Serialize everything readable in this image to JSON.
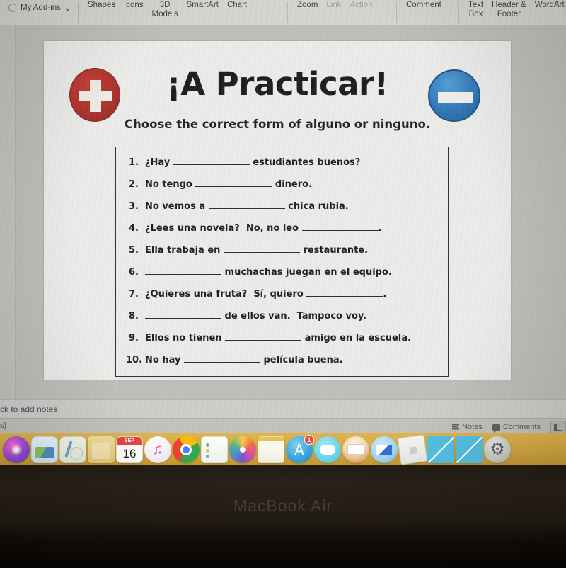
{
  "ribbon": {
    "addins_label": "My Add-ins",
    "addins_caret": "⌄",
    "groups": [
      {
        "items": [
          {
            "label": "Shapes",
            "disabled": false
          },
          {
            "label": "Icons",
            "disabled": false
          },
          {
            "label": "3D\nModels",
            "disabled": false
          },
          {
            "label": "SmartArt",
            "disabled": false
          },
          {
            "label": "Chart",
            "disabled": false
          }
        ]
      },
      {
        "items": [
          {
            "label": "Zoom",
            "disabled": false
          },
          {
            "label": "Link",
            "disabled": true
          },
          {
            "label": "Action",
            "disabled": true
          }
        ]
      },
      {
        "items": [
          {
            "label": "Comment",
            "disabled": false
          }
        ]
      },
      {
        "items": [
          {
            "label": "Text\nBox",
            "disabled": false
          },
          {
            "label": "Header &\nFooter",
            "disabled": false
          },
          {
            "label": "WordArt",
            "disabled": false
          }
        ]
      }
    ]
  },
  "slide": {
    "title": "¡A Practicar!",
    "subtitle": "Choose the correct form of alguno or ninguno.",
    "plus_icon": "plus-circle-icon",
    "minus_icon": "minus-circle-icon",
    "exercises": [
      {
        "num": "1.",
        "before": "¿Hay ",
        "after": " estudiantes buenos?",
        "blank_width": 108
      },
      {
        "num": "2.",
        "before": "No tengo ",
        "after": " dinero.",
        "blank_width": 108
      },
      {
        "num": "3.",
        "before": "No vemos a ",
        "after": " chica rubia.",
        "blank_width": 108
      },
      {
        "num": "4.",
        "before": "¿Lees una novela?  No, no leo ",
        "after": ".",
        "blank_width": 108
      },
      {
        "num": "5.",
        "before": "Ella trabaja en ",
        "after": " restaurante.",
        "blank_width": 108
      },
      {
        "num": "6.",
        "before": "",
        "after": " muchachas juegan en el equipo.",
        "blank_width": 108
      },
      {
        "num": "7.",
        "before": "¿Quieres una fruta?  Sí, quiero ",
        "after": ".",
        "blank_width": 108
      },
      {
        "num": "8.",
        "before": "",
        "after": " de ellos van.  Tampoco voy.",
        "blank_width": 108
      },
      {
        "num": "9.",
        "before": "Ellos no tienen ",
        "after": " amigo en la escuela.",
        "blank_width": 108
      },
      {
        "num": "10.",
        "before": "No hay ",
        "after": " película buena.",
        "blank_width": 108
      }
    ]
  },
  "notes": {
    "placeholder": "ck to add notes"
  },
  "status": {
    "left_text": "s)",
    "notes_label": "Notes",
    "comments_label": "Comments",
    "notes_icon": "notes-icon",
    "comments_icon": "comment-icon",
    "view_icon": "reading-view-icon"
  },
  "dock": {
    "items": [
      {
        "name": "siri",
        "cls": "ic-siri round",
        "badge": null
      },
      {
        "name": "preview",
        "cls": "ic-photoapp",
        "badge": null
      },
      {
        "name": "maps",
        "cls": "ic-maps",
        "badge": null
      },
      {
        "name": "folder",
        "cls": "ic-folder",
        "badge": null
      },
      {
        "name": "calendar",
        "cls": "ic-cal",
        "badge": null,
        "month": "SEP",
        "day": "16"
      },
      {
        "name": "music",
        "cls": "ic-music round",
        "badge": null
      },
      {
        "name": "chrome",
        "cls": "ic-chrome round",
        "badge": null
      },
      {
        "name": "notes",
        "cls": "ic-notes",
        "badge": null
      },
      {
        "name": "photos",
        "cls": "ic-photos round",
        "badge": null
      },
      {
        "name": "pages",
        "cls": "ic-pages",
        "badge": null
      },
      {
        "name": "app-store",
        "cls": "ic-appstore round",
        "badge": "1"
      },
      {
        "name": "messages",
        "cls": "ic-messages round",
        "badge": null
      },
      {
        "name": "books",
        "cls": "ic-books round",
        "badge": null
      },
      {
        "name": "mail",
        "cls": "ic-mail round",
        "badge": null
      },
      {
        "name": "roblox",
        "cls": "ic-roblox",
        "badge": null
      },
      {
        "name": "cyan-app-1",
        "cls": "ic-cyan",
        "badge": null
      },
      {
        "name": "cyan-app-2",
        "cls": "ic-cyan",
        "badge": null
      },
      {
        "name": "system-preferences",
        "cls": "ic-sysprefs round",
        "badge": null
      }
    ]
  },
  "device": {
    "model_label": "MacBook Air"
  }
}
